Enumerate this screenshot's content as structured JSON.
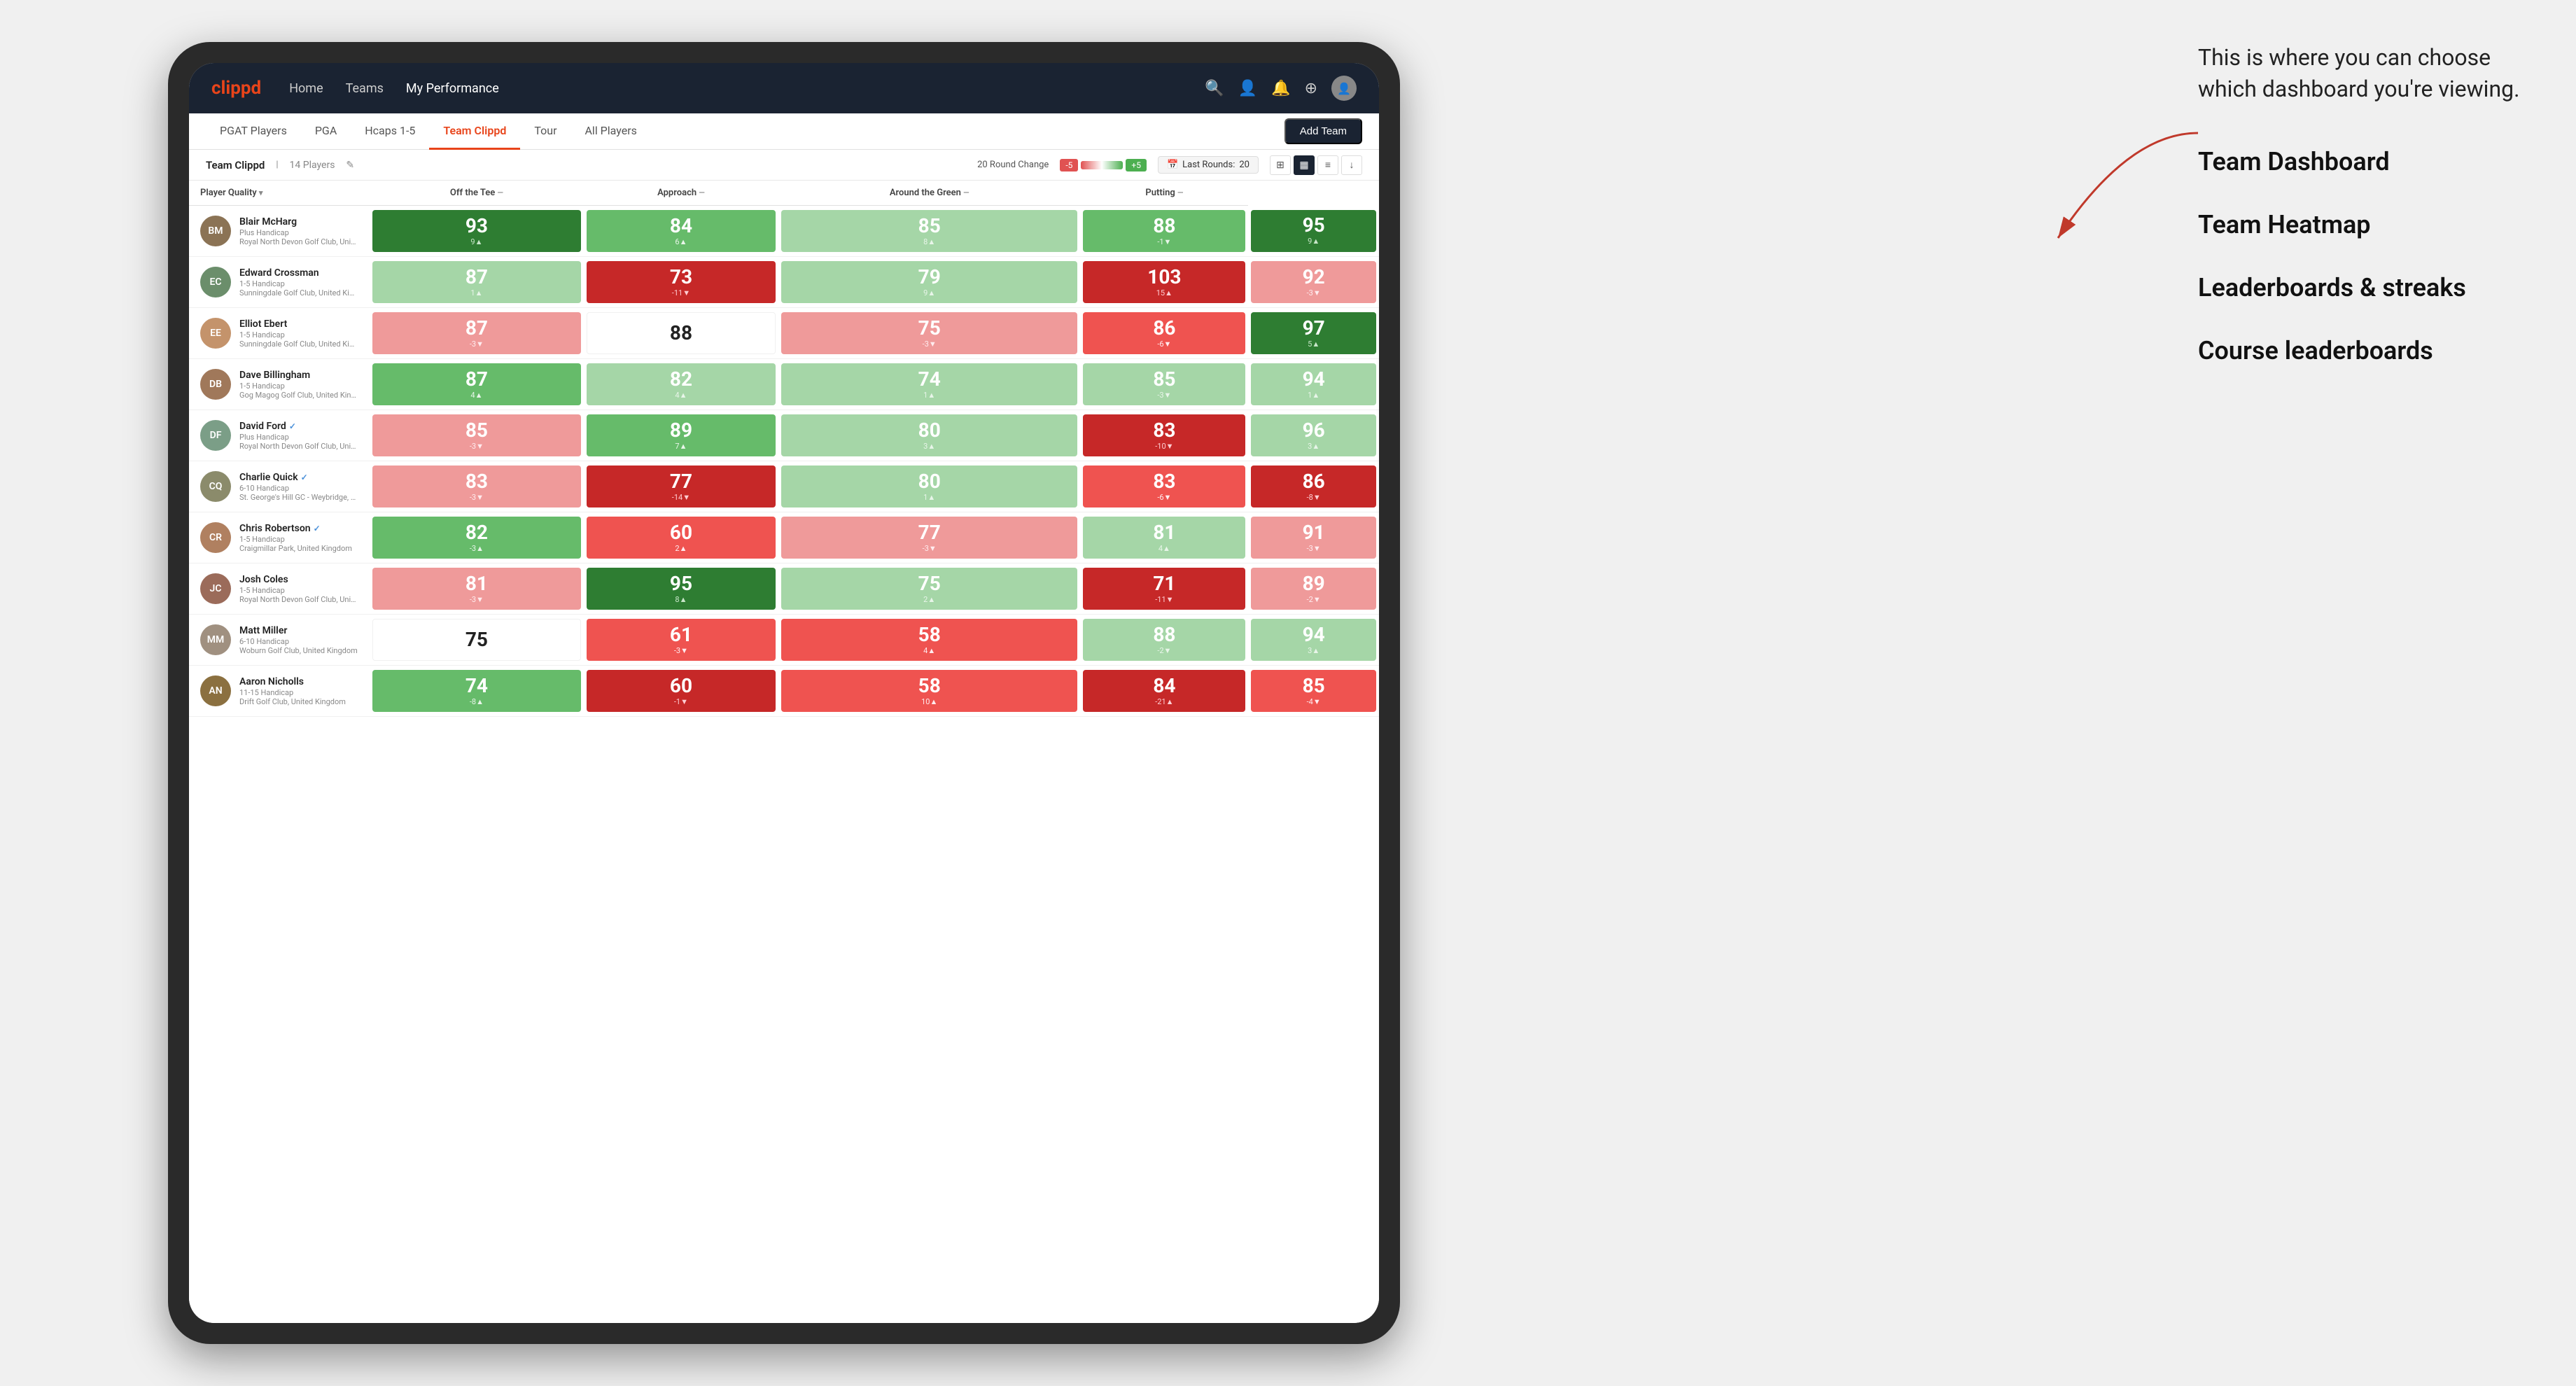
{
  "annotation": {
    "intro": "This is where you can choose which dashboard you're viewing.",
    "items": [
      {
        "label": "Team Dashboard"
      },
      {
        "label": "Team Heatmap"
      },
      {
        "label": "Leaderboards & streaks"
      },
      {
        "label": "Course leaderboards"
      }
    ]
  },
  "navbar": {
    "logo": "clippd",
    "nav_items": [
      {
        "label": "Home",
        "active": false
      },
      {
        "label": "Teams",
        "active": false
      },
      {
        "label": "My Performance",
        "active": true
      }
    ],
    "icons": [
      "🔍",
      "👤",
      "🔔",
      "⊕",
      "👤"
    ]
  },
  "subnav": {
    "items": [
      {
        "label": "PGAT Players",
        "active": false
      },
      {
        "label": "PGA",
        "active": false
      },
      {
        "label": "Hcaps 1-5",
        "active": false
      },
      {
        "label": "Team Clippd",
        "active": true
      },
      {
        "label": "Tour",
        "active": false
      },
      {
        "label": "All Players",
        "active": false
      }
    ],
    "add_button": "Add Team"
  },
  "team_bar": {
    "name": "Team Clippd",
    "count": "14 Players",
    "round_change_label": "20 Round Change",
    "badge_red": "-5",
    "badge_green": "+5",
    "last_rounds_label": "Last Rounds:",
    "last_rounds_value": "20"
  },
  "table": {
    "headers": [
      {
        "label": "Player Quality",
        "arrow": "▾"
      },
      {
        "label": "Off the Tee",
        "arrow": "—"
      },
      {
        "label": "Approach",
        "arrow": "—"
      },
      {
        "label": "Around the Green",
        "arrow": "—"
      },
      {
        "label": "Putting",
        "arrow": "—"
      }
    ],
    "players": [
      {
        "name": "Blair McHarg",
        "handicap": "Plus Handicap",
        "club": "Royal North Devon Golf Club, United Kingdom",
        "verified": false,
        "avatar_color": "#8B7355",
        "scores": [
          {
            "value": "93",
            "change": "9▲",
            "color": "green-dark"
          },
          {
            "value": "84",
            "change": "6▲",
            "color": "green-mid"
          },
          {
            "value": "85",
            "change": "8▲",
            "color": "green-light"
          },
          {
            "value": "88",
            "change": "-1▼",
            "color": "green-mid"
          },
          {
            "value": "95",
            "change": "9▲",
            "color": "green-dark"
          }
        ]
      },
      {
        "name": "Edward Crossman",
        "handicap": "1-5 Handicap",
        "club": "Sunningdale Golf Club, United Kingdom",
        "verified": false,
        "avatar_color": "#6B8E6B",
        "scores": [
          {
            "value": "87",
            "change": "1▲",
            "color": "green-light"
          },
          {
            "value": "73",
            "change": "-11▼",
            "color": "red-dark"
          },
          {
            "value": "79",
            "change": "9▲",
            "color": "green-light"
          },
          {
            "value": "103",
            "change": "15▲",
            "color": "red-dark"
          },
          {
            "value": "92",
            "change": "-3▼",
            "color": "red-light"
          }
        ]
      },
      {
        "name": "Elliot Ebert",
        "handicap": "1-5 Handicap",
        "club": "Sunningdale Golf Club, United Kingdom",
        "verified": false,
        "avatar_color": "#C4936B",
        "scores": [
          {
            "value": "87",
            "change": "-3▼",
            "color": "red-light"
          },
          {
            "value": "88",
            "change": "",
            "color": "neutral"
          },
          {
            "value": "75",
            "change": "-3▼",
            "color": "red-light"
          },
          {
            "value": "86",
            "change": "-6▼",
            "color": "red-mid"
          },
          {
            "value": "97",
            "change": "5▲",
            "color": "green-dark"
          }
        ]
      },
      {
        "name": "Dave Billingham",
        "handicap": "1-5 Handicap",
        "club": "Gog Magog Golf Club, United Kingdom",
        "verified": false,
        "avatar_color": "#A0785A",
        "scores": [
          {
            "value": "87",
            "change": "4▲",
            "color": "green-mid"
          },
          {
            "value": "82",
            "change": "4▲",
            "color": "green-light"
          },
          {
            "value": "74",
            "change": "1▲",
            "color": "green-light"
          },
          {
            "value": "85",
            "change": "-3▼",
            "color": "green-light"
          },
          {
            "value": "94",
            "change": "1▲",
            "color": "green-light"
          }
        ]
      },
      {
        "name": "David Ford",
        "handicap": "Plus Handicap",
        "club": "Royal North Devon Golf Club, United Kingdom",
        "verified": true,
        "avatar_color": "#7B9E87",
        "scores": [
          {
            "value": "85",
            "change": "-3▼",
            "color": "red-light"
          },
          {
            "value": "89",
            "change": "7▲",
            "color": "green-mid"
          },
          {
            "value": "80",
            "change": "3▲",
            "color": "green-light"
          },
          {
            "value": "83",
            "change": "-10▼",
            "color": "red-dark"
          },
          {
            "value": "96",
            "change": "3▲",
            "color": "green-light"
          }
        ]
      },
      {
        "name": "Charlie Quick",
        "handicap": "6-10 Handicap",
        "club": "St. George's Hill GC - Weybridge, Surrey, Uni...",
        "verified": true,
        "avatar_color": "#8B8B6B",
        "scores": [
          {
            "value": "83",
            "change": "-3▼",
            "color": "red-light"
          },
          {
            "value": "77",
            "change": "-14▼",
            "color": "red-dark"
          },
          {
            "value": "80",
            "change": "1▲",
            "color": "green-light"
          },
          {
            "value": "83",
            "change": "-6▼",
            "color": "red-mid"
          },
          {
            "value": "86",
            "change": "-8▼",
            "color": "red-dark"
          }
        ]
      },
      {
        "name": "Chris Robertson",
        "handicap": "1-5 Handicap",
        "club": "Craigmillar Park, United Kingdom",
        "verified": true,
        "avatar_color": "#B08060",
        "scores": [
          {
            "value": "82",
            "change": "-3▲",
            "color": "green-mid"
          },
          {
            "value": "60",
            "change": "2▲",
            "color": "red-mid"
          },
          {
            "value": "77",
            "change": "-3▼",
            "color": "red-light"
          },
          {
            "value": "81",
            "change": "4▲",
            "color": "green-light"
          },
          {
            "value": "91",
            "change": "-3▼",
            "color": "red-light"
          }
        ]
      },
      {
        "name": "Josh Coles",
        "handicap": "1-5 Handicap",
        "club": "Royal North Devon Golf Club, United Kingdom",
        "verified": false,
        "avatar_color": "#9B6B5A",
        "scores": [
          {
            "value": "81",
            "change": "-3▼",
            "color": "red-light"
          },
          {
            "value": "95",
            "change": "8▲",
            "color": "green-dark"
          },
          {
            "value": "75",
            "change": "2▲",
            "color": "green-light"
          },
          {
            "value": "71",
            "change": "-11▼",
            "color": "red-dark"
          },
          {
            "value": "89",
            "change": "-2▼",
            "color": "red-light"
          }
        ]
      },
      {
        "name": "Matt Miller",
        "handicap": "6-10 Handicap",
        "club": "Woburn Golf Club, United Kingdom",
        "verified": false,
        "avatar_color": "#A09080",
        "scores": [
          {
            "value": "75",
            "change": "",
            "color": "neutral"
          },
          {
            "value": "61",
            "change": "-3▼",
            "color": "red-mid"
          },
          {
            "value": "58",
            "change": "4▲",
            "color": "red-mid"
          },
          {
            "value": "88",
            "change": "-2▼",
            "color": "green-light"
          },
          {
            "value": "94",
            "change": "3▲",
            "color": "green-light"
          }
        ]
      },
      {
        "name": "Aaron Nicholls",
        "handicap": "11-15 Handicap",
        "club": "Drift Golf Club, United Kingdom",
        "verified": false,
        "avatar_color": "#8B7040",
        "scores": [
          {
            "value": "74",
            "change": "-8▲",
            "color": "green-mid"
          },
          {
            "value": "60",
            "change": "-1▼",
            "color": "red-dark"
          },
          {
            "value": "58",
            "change": "10▲",
            "color": "red-mid"
          },
          {
            "value": "84",
            "change": "-21▲",
            "color": "red-dark"
          },
          {
            "value": "85",
            "change": "-4▼",
            "color": "red-mid"
          }
        ]
      }
    ]
  }
}
